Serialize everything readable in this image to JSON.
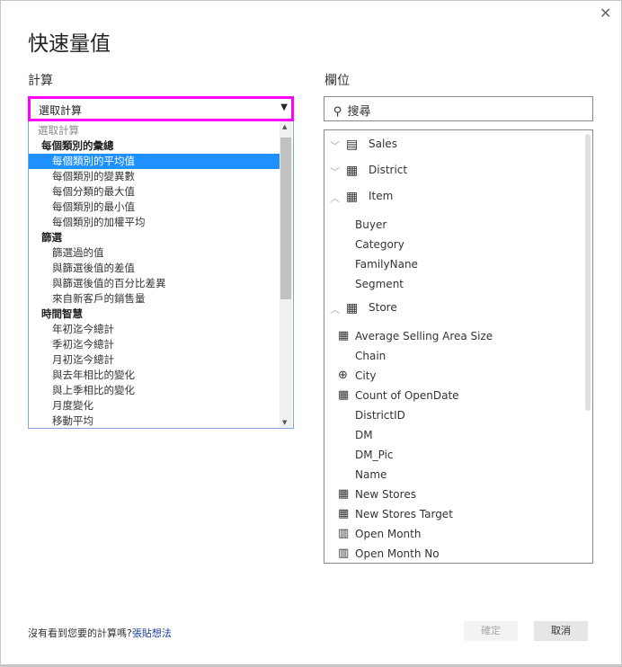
{
  "dialog": {
    "title": "快速量值",
    "close_icon": "close-icon"
  },
  "calc": {
    "label": "計算",
    "selected": "選取計算",
    "items": [
      {
        "text": "選取計算",
        "kind": "placeholder"
      },
      {
        "text": "每個類別的彙總",
        "kind": "group"
      },
      {
        "text": "每個類別的平均值",
        "kind": "item",
        "selected": true
      },
      {
        "text": "每個類別的變異數",
        "kind": "item"
      },
      {
        "text": "每個分類的最大值",
        "kind": "item"
      },
      {
        "text": "每個類別的最小值",
        "kind": "item"
      },
      {
        "text": "每個類別的加權平均",
        "kind": "item"
      },
      {
        "text": "篩選",
        "kind": "group"
      },
      {
        "text": "篩選過的值",
        "kind": "item"
      },
      {
        "text": "與篩選後值的差值",
        "kind": "item"
      },
      {
        "text": "與篩選後值的百分比差異",
        "kind": "item"
      },
      {
        "text": "來自新客戶的銷售量",
        "kind": "item"
      },
      {
        "text": "時間智慧",
        "kind": "group"
      },
      {
        "text": "年初迄今總計",
        "kind": "item"
      },
      {
        "text": "季初迄今總計",
        "kind": "item"
      },
      {
        "text": "月初迄今總計",
        "kind": "item"
      },
      {
        "text": "與去年相比的變化",
        "kind": "item"
      },
      {
        "text": "與上季相比的變化",
        "kind": "item"
      },
      {
        "text": "月度變化",
        "kind": "item"
      },
      {
        "text": "移動平均",
        "kind": "item"
      }
    ]
  },
  "fields": {
    "label": "欄位",
    "search_placeholder": "搜尋",
    "tables": [
      {
        "name": "Sales",
        "icon": "calculator-table-icon",
        "expanded": false
      },
      {
        "name": "District",
        "icon": "table-icon",
        "expanded": false
      },
      {
        "name": "Item",
        "icon": "table-icon",
        "expanded": true,
        "fields": [
          {
            "name": "Buyer",
            "icon": ""
          },
          {
            "name": "Category",
            "icon": ""
          },
          {
            "name": "FamilyNane",
            "icon": ""
          },
          {
            "name": "Segment",
            "icon": ""
          }
        ]
      },
      {
        "name": "Store",
        "icon": "table-icon",
        "expanded": true,
        "fields": [
          {
            "name": "Average Selling Area Size",
            "icon": "calculator-icon"
          },
          {
            "name": "Chain",
            "icon": ""
          },
          {
            "name": "City",
            "icon": "globe-icon"
          },
          {
            "name": "Count of OpenDate",
            "icon": "calculator-icon"
          },
          {
            "name": "DistrictID",
            "icon": ""
          },
          {
            "name": "DM",
            "icon": ""
          },
          {
            "name": "DM_Pic",
            "icon": ""
          },
          {
            "name": "Name",
            "icon": ""
          },
          {
            "name": "New Stores",
            "icon": "calculator-icon"
          },
          {
            "name": "New Stores Target",
            "icon": "calculator-icon"
          },
          {
            "name": "Open Month",
            "icon": "calculated-column-icon"
          },
          {
            "name": "Open Month No",
            "icon": "calculated-column-icon"
          }
        ]
      }
    ]
  },
  "footer": {
    "question": "沒有看到您要的計算嗎?",
    "link": "張貼想法",
    "ok": "確定",
    "cancel": "取消"
  }
}
